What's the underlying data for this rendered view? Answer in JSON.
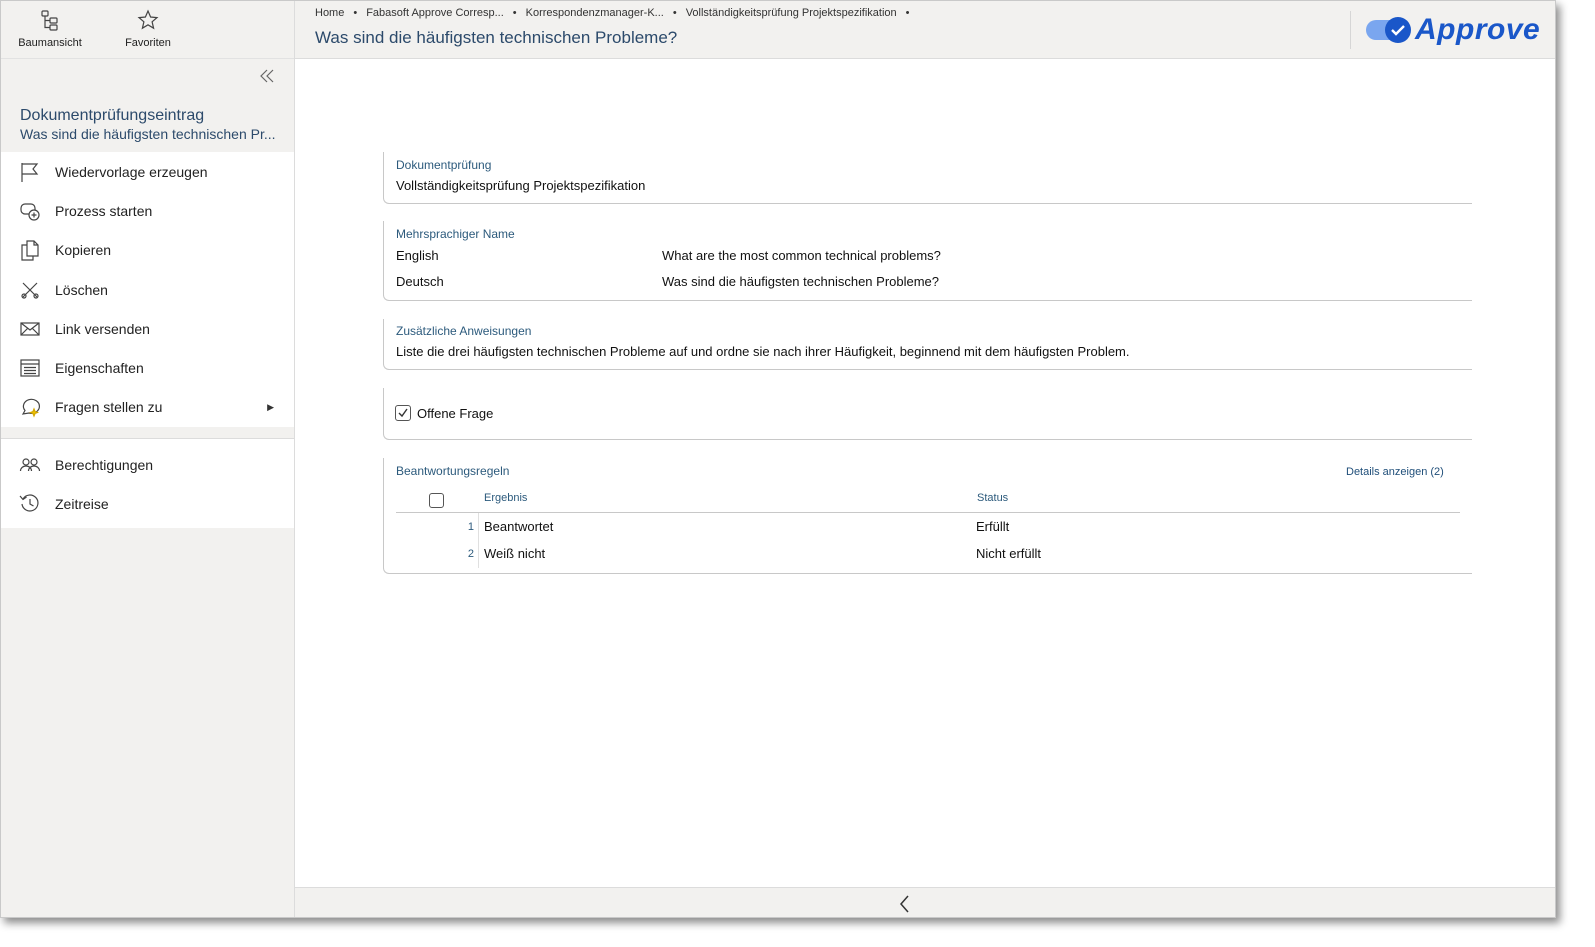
{
  "topnav": {
    "tree_label": "Baumansicht",
    "fav_label": "Favoriten"
  },
  "object": {
    "type": "Dokumentprüfungseintrag",
    "name": "Was sind die häufigsten technischen Pr..."
  },
  "menu": {
    "items": [
      {
        "label": "Wiedervorlage erzeugen",
        "icon": "flag-icon"
      },
      {
        "label": "Prozess starten",
        "icon": "process-start-icon"
      },
      {
        "label": "Kopieren",
        "icon": "copy-icon"
      },
      {
        "label": "Löschen",
        "icon": "delete-icon"
      },
      {
        "label": "Link versenden",
        "icon": "mail-icon"
      },
      {
        "label": "Eigenschaften",
        "icon": "properties-icon"
      },
      {
        "label": "Fragen stellen zu",
        "icon": "ai-question-icon"
      }
    ],
    "items2": [
      {
        "label": "Berechtigungen",
        "icon": "users-icon"
      },
      {
        "label": "Zeitreise",
        "icon": "history-icon"
      }
    ]
  },
  "breadcrumb": [
    "Home",
    "Fabasoft Approve Corresp...",
    "Korrespondenzmanager-K...",
    "Vollständigkeitsprüfung Projektspezifikation"
  ],
  "page_title": "Was sind die häufigsten technischen Probleme?",
  "logo_text": "Approve",
  "brand_color": "#1a57c9",
  "sections": {
    "docreview": {
      "caption": "Dokumentprüfung",
      "value": "Vollständigkeitsprüfung Projektspezifikation"
    },
    "multilang": {
      "caption": "Mehrsprachiger Name",
      "rows": [
        {
          "lang": "English",
          "text": "What are the most common technical problems?"
        },
        {
          "lang": "Deutsch",
          "text": "Was sind die häufigsten technischen Probleme?"
        }
      ]
    },
    "instructions": {
      "caption": "Zusätzliche Anweisungen",
      "value": "Liste die drei häufigsten technischen Probleme auf und ordne sie nach ihrer Häufigkeit, beginnend mit dem häufigsten Problem."
    },
    "openq": {
      "label": "Offene Frage",
      "checked": true
    },
    "rules": {
      "caption": "Beantwortungsregeln",
      "details_link": "Details anzeigen (2)",
      "columns": [
        "Ergebnis",
        "Status"
      ],
      "rows": [
        {
          "num": "1",
          "result": "Beantwortet",
          "status": "Erfüllt"
        },
        {
          "num": "2",
          "result": "Weiß nicht",
          "status": "Nicht erfüllt"
        }
      ]
    }
  }
}
